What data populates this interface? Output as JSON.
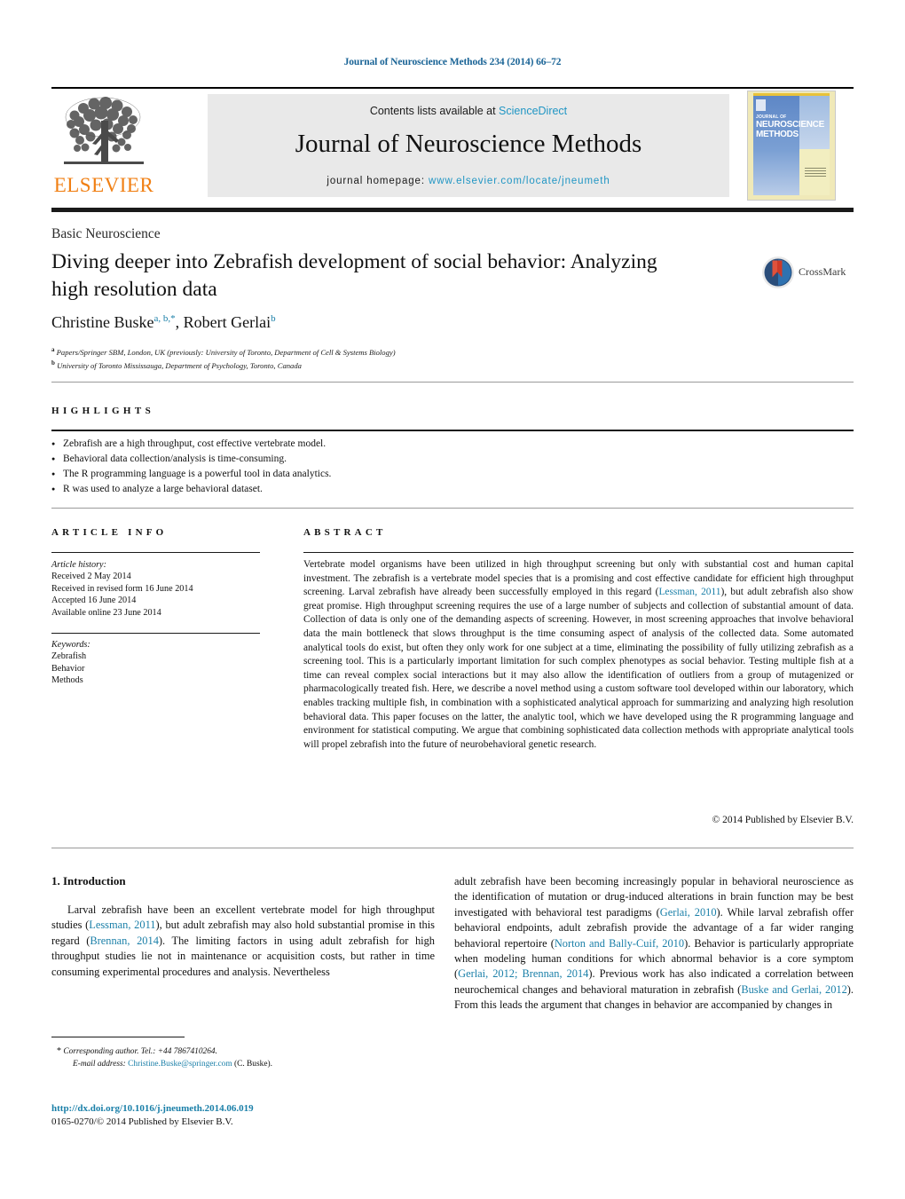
{
  "running_head": "Journal of Neuroscience Methods 234 (2014) 66–72",
  "masthead": {
    "publisher_name": "ELSEVIER",
    "contents_prefix": "Contents lists available at ",
    "contents_link": "ScienceDirect",
    "journal_title": "Journal of Neuroscience Methods",
    "homepage_prefix": "journal homepage: ",
    "homepage_url": "www.elsevier.com/locate/jneumeth",
    "cover": {
      "line1": "JOURNAL OF",
      "line2": "NEUROSCIENCE",
      "line3": "METHODS"
    }
  },
  "section_label": "Basic Neuroscience",
  "title": "Diving deeper into Zebrafish development of social behavior: Analyzing high resolution data",
  "crossmark_label": "CrossMark",
  "authors": {
    "author1_name": "Christine Buske",
    "author1_sup": "a, b,",
    "author1_star": "*",
    "separator": ", ",
    "author2_name": "Robert Gerlai",
    "author2_sup": "b"
  },
  "affiliations": [
    {
      "marker": "a",
      "text": "Papers/Springer SBM, London, UK (previously: University of Toronto, Department of Cell & Systems Biology)"
    },
    {
      "marker": "b",
      "text": "University of Toronto Mississauga, Department of Psychology, Toronto, Canada"
    }
  ],
  "highlights": {
    "heading": "HIGHLIGHTS",
    "items": [
      "Zebrafish are a high throughput, cost effective vertebrate model.",
      "Behavioral data collection/analysis is time-consuming.",
      "The R programming language is a powerful tool in data analytics.",
      "R was used to analyze a large behavioral dataset."
    ]
  },
  "article_info": {
    "heading": "ARTICLE INFO",
    "history_label": "Article history:",
    "history": [
      "Received 2 May 2014",
      "Received in revised form 16 June 2014",
      "Accepted 16 June 2014",
      "Available online 23 June 2014"
    ],
    "keywords_label": "Keywords:",
    "keywords": [
      "Zebrafish",
      "Behavior",
      "Methods"
    ]
  },
  "abstract": {
    "heading": "ABSTRACT",
    "part1": "Vertebrate model organisms have been utilized in high throughput screening but only with substantial cost and human capital investment. The zebrafish is a vertebrate model species that is a promising and cost effective candidate for efficient high throughput screening. Larval zebrafish have already been successfully employed in this regard (",
    "ref1": "Lessman, 2011",
    "part2": "), but adult zebrafish also show great promise. High throughput screening requires the use of a large number of subjects and collection of substantial amount of data. Collection of data is only one of the demanding aspects of screening. However, in most screening approaches that involve behavioral data the main bottleneck that slows throughput is the time consuming aspect of analysis of the collected data. Some automated analytical tools do exist, but often they only work for one subject at a time, eliminating the possibility of fully utilizing zebrafish as a screening tool. This is a particularly important limitation for such complex phenotypes as social behavior. Testing multiple fish at a time can reveal complex social interactions but it may also allow the identification of outliers from a group of mutagenized or pharmacologically treated fish. Here, we describe a novel method using a custom software tool developed within our laboratory, which enables tracking multiple fish, in combination with a sophisticated analytical approach for summarizing and analyzing high resolution behavioral data. This paper focuses on the latter, the analytic tool, which we have developed using the R programming language and environment for statistical computing. We argue that combining sophisticated data collection methods with appropriate analytical tools will propel zebrafish into the future of neurobehavioral genetic research.",
    "copyright": "© 2014 Published by Elsevier B.V."
  },
  "introduction": {
    "heading": "1. Introduction",
    "left_p1_a": "Larval zebrafish have been an excellent vertebrate model for high throughput studies (",
    "left_ref1": "Lessman, 2011",
    "left_p1_b": "), but adult zebrafish may also hold substantial promise in this regard (",
    "left_ref2": "Brennan, 2014",
    "left_p1_c": "). The limiting factors in using adult zebrafish for high throughput studies lie not in maintenance or acquisition costs, but rather in time consuming experimental procedures and analysis. Nevertheless",
    "right_a": "adult zebrafish have been becoming increasingly popular in behavioral neuroscience as the identification of mutation or drug-induced alterations in brain function may be best investigated with behavioral test paradigms (",
    "right_ref1": "Gerlai, 2010",
    "right_b": "). While larval zebrafish offer behavioral endpoints, adult zebrafish provide the advantage of a far wider ranging behavioral repertoire (",
    "right_ref2": "Norton and Bally-Cuif, 2010",
    "right_c": "). Behavior is particularly appropriate when modeling human conditions for which abnormal behavior is a core symptom (",
    "right_ref3": "Gerlai, 2012; Brennan, 2014",
    "right_d": "). Previous work has also indicated a correlation between neurochemical changes and behavioral maturation in zebrafish (",
    "right_ref4": "Buske and Gerlai, 2012",
    "right_e": "). From this leads the argument that changes in behavior are accompanied by changes in"
  },
  "footnote": {
    "star": "*",
    "corresponding": " Corresponding author. Tel.: +44 7867410264.",
    "email_label": "E-mail address:",
    "email": "Christine.Buske@springer.com",
    "email_suffix": " (C. Buske)."
  },
  "doi": "http://dx.doi.org/10.1016/j.jneumeth.2014.06.019",
  "issn_line": "0165-0270/© 2014 Published by Elsevier B.V.",
  "colors": {
    "link_blue": "#1a7fa8",
    "sciencedirect_blue": "#2196c4",
    "elsevier_orange": "#F07F13",
    "running_head_blue": "#1a6496"
  }
}
